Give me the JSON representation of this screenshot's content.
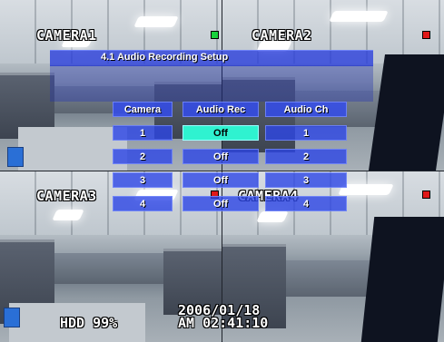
{
  "cameras": [
    {
      "label": "CAMERA1",
      "indicator_color": "#19d23c"
    },
    {
      "label": "CAMERA2",
      "indicator_color": "#e01818"
    },
    {
      "label": "CAMERA3",
      "indicator_color": "#e01818"
    },
    {
      "label": "CAMERA4",
      "indicator_color": "#e01818"
    }
  ],
  "menu": {
    "title": "4.1 Audio Recording Setup",
    "columns": [
      "Camera",
      "Audio Rec",
      "Audio Ch"
    ],
    "rows": [
      {
        "camera": "1",
        "audio_rec": "Off",
        "audio_ch": "1"
      },
      {
        "camera": "2",
        "audio_rec": "Off",
        "audio_ch": "2"
      },
      {
        "camera": "3",
        "audio_rec": "Off",
        "audio_ch": "3"
      },
      {
        "camera": "4",
        "audio_rec": "Off",
        "audio_ch": "4"
      }
    ],
    "selected_cell": "row1-audio_rec",
    "selected_color": "#2ff2d0",
    "menu_color": "#2d46e6"
  },
  "status": {
    "hdd": "HDD 99%",
    "date": "2006/01/18",
    "time": "AM 02:41:10"
  }
}
